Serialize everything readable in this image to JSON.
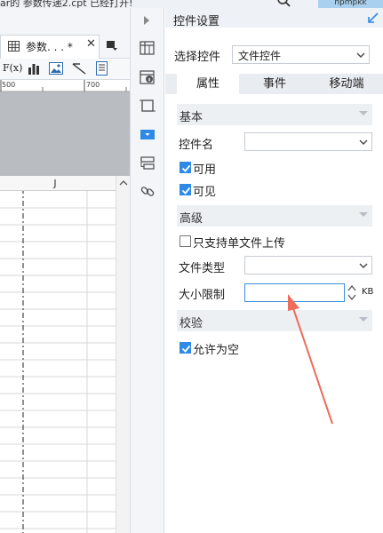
{
  "top": {
    "file_text": "ar的  参数传递2.cpt 已经打开!",
    "user": "hpmpkk"
  },
  "editor": {
    "tab_title": "参数. . .  *",
    "tab_close": "✕",
    "ruler": {
      "r500": "500",
      "r700": "700"
    },
    "column_label": "J",
    "toolbar_fx": "F(x)"
  },
  "panel": {
    "title": "控件设置",
    "select_label": "选择控件",
    "select_value": "文件控件",
    "tabs": [
      "属性",
      "事件",
      "移动端"
    ],
    "active_tab": 0,
    "sections": {
      "basic": "基本",
      "advanced": "高级",
      "validate": "校验"
    },
    "name_label": "控件名",
    "name_value": "",
    "visible_cb": {
      "label": "可用",
      "checked": true
    },
    "visible2_cb": {
      "label": "可见",
      "checked": true
    },
    "single_upload_cb": {
      "label": "只支持单文件上传",
      "checked": false
    },
    "file_type_label": "文件类型",
    "file_type_value": "",
    "size_label": "大小限制",
    "size_value": "",
    "size_unit": "KB",
    "allow_empty_cb": {
      "label": "允许为空",
      "checked": true
    }
  },
  "colors": {
    "accent": "#2f8ae5",
    "arrow": "#ef6b5a",
    "active_field_border": "#3d8fe0"
  },
  "icons": [
    "search-icon",
    "pin-icon",
    "chevron-down-icon",
    "check-icon",
    "link-icon",
    "widget-icon"
  ]
}
